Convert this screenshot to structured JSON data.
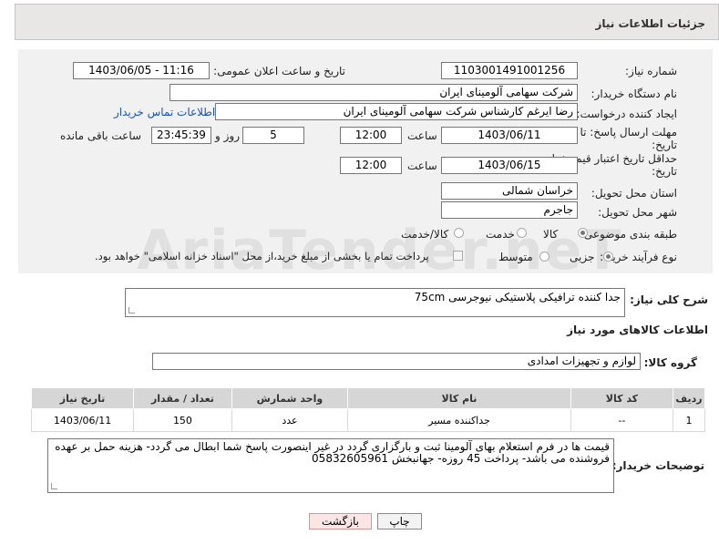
{
  "header": {
    "title": "جزئیات اطلاعات نیاز"
  },
  "need_number": {
    "label": "شماره نیاز:",
    "value": "1103001491001256"
  },
  "announce": {
    "label": "تاریخ و ساعت اعلان عمومی:",
    "value": "1403/06/05 - 11:16"
  },
  "buyer_org": {
    "label": "نام دستگاه خریدار:",
    "value": "شرکت سهامی آلومینای ایران"
  },
  "creator": {
    "label": "ایجاد کننده درخواست:",
    "value": "رضا ایرغم کارشناس شرکت سهامی آلومینای ایران",
    "contact_link": "اطلاعات تماس خریدار"
  },
  "reply_deadline": {
    "label_line1": "مهلت ارسال پاسخ: تا",
    "label_line2": "تاریخ:",
    "date": "1403/06/11",
    "time_label": "ساعت",
    "time": "12:00",
    "days": "5",
    "days_label": "روز و",
    "remaining": "23:45:39",
    "remaining_label": "ساعت باقی مانده"
  },
  "price_validity": {
    "label_line1": "حداقل تاریخ اعتبار قیمت: تا",
    "label_line2": "تاریخ:",
    "date": "1403/06/15",
    "time_label": "ساعت",
    "time": "12:00"
  },
  "province": {
    "label": "استان محل تحویل:",
    "value": "خراسان شمالی"
  },
  "city": {
    "label": "شهر محل تحویل:",
    "value": "جاجرم"
  },
  "category": {
    "label": "طبقه بندی موضوعی:",
    "options": [
      "کالا",
      "خدمت",
      "کالا/خدمت"
    ],
    "selected": "کالا"
  },
  "purchase_type": {
    "label": "نوع فرآیند خرید :",
    "options": [
      "جزیی",
      "متوسط"
    ],
    "selected": "جزیی",
    "payment_note": "پرداخت تمام یا بخشی از مبلغ خرید،از محل \"اسناد خزانه اسلامی\" خواهد بود."
  },
  "description": {
    "label": "شرح کلی نیاز:",
    "value": "جدا کننده ترافیکی پلاستیکی نیوجرسی 75cm"
  },
  "goods_info": {
    "title": "اطلاعات کالاهای مورد نیاز"
  },
  "goods_group": {
    "label": "گروه کالا:",
    "value": "لوازم و تجهیزات امدادی"
  },
  "goods_table": {
    "headers": [
      "ردیف",
      "کد کالا",
      "نام کالا",
      "واحد شمارش",
      "تعداد / مقدار",
      "تاریخ نیاز"
    ],
    "rows": [
      [
        "1",
        "--",
        "جداکننده مسیر",
        "عدد",
        "150",
        "1403/06/11"
      ]
    ]
  },
  "buyer_notes": {
    "label": "توضیحات خریدار:",
    "value": "قیمت ها در فرم استعلام بهای آلومینا ثبت و بارگزاری گردد در غیر اینصورت پاسخ شما ابطال می گردد- هزینه حمل بر عهده فروشنده می باشد- پرداخت 45 روزه- جهانبخش 05832605961"
  },
  "buttons": {
    "print": "چاپ",
    "back": "بازگشت"
  },
  "watermark": "AriaTender.neT"
}
